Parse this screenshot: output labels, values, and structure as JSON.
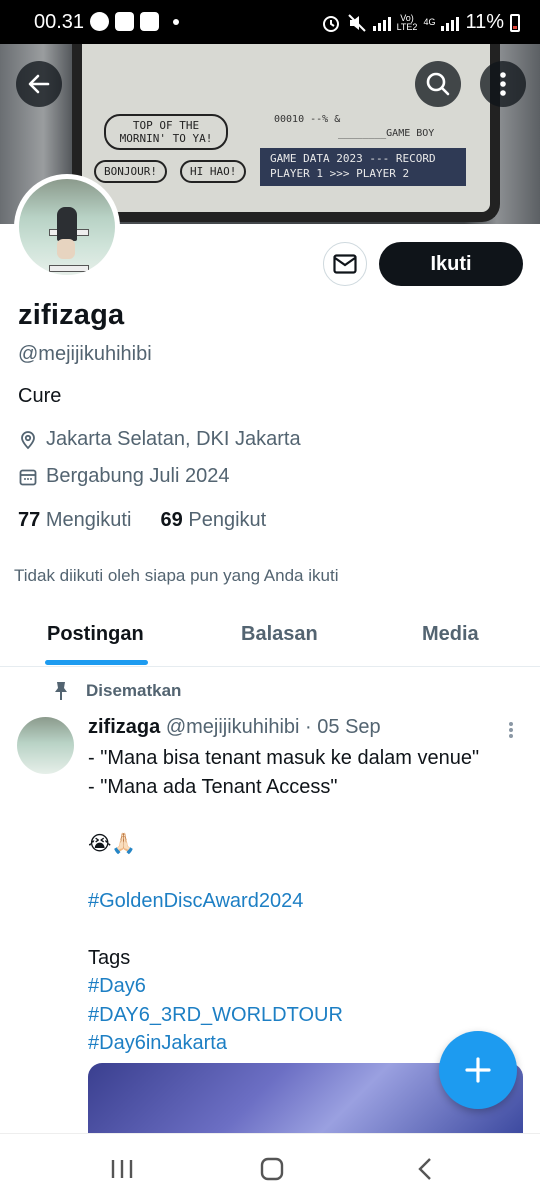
{
  "status_bar": {
    "time": "00.31",
    "network_small_1": "Vo)",
    "network_small_2": "LTE2",
    "network_type": "4G",
    "battery": "11%"
  },
  "banner": {
    "bubble_1": "TOP OF THE MORNIN' TO YA!",
    "bubble_2": "BONJOUR!",
    "bubble_3": "HI HAO!",
    "score_text": "00010 --% &",
    "game_boy_text": "________GAME BOY",
    "record_line_1": "GAME DATA  2023 --- RECORD",
    "record_line_2": "PLAYER 1  >>>  PLAYER 2"
  },
  "profile": {
    "follow_label": "Ikuti",
    "name": "zifizaga",
    "handle": "@mejijikuhihibi",
    "bio": "Cure",
    "location": "Jakarta Selatan, DKI Jakarta",
    "joined": "Bergabung Juli 2024",
    "following_count": "77",
    "following_label": "Mengikuti",
    "followers_count": "69",
    "followers_label": "Pengikut",
    "not_followed_text": "Tidak diikuti oleh siapa pun yang Anda ikuti"
  },
  "tabs": [
    {
      "label": "Postingan",
      "active": true
    },
    {
      "label": "Balasan",
      "active": false
    },
    {
      "label": "Media",
      "active": false
    }
  ],
  "pinned_post": {
    "pinned_label": "Disematkan",
    "author": "zifizaga",
    "handle_date": "@mejijikuhihibi · 05 Sep",
    "lines": [
      "- \"Mana bisa tenant masuk ke dalam venue\"",
      "- \"Mana ada Tenant Access\"",
      "",
      "😭🙏🏻",
      "",
      "#GoldenDiscAward2024",
      "",
      "Tags",
      "#Day6",
      "#DAY6_3RD_WORLDTOUR",
      "#Day6inJakarta"
    ]
  },
  "colors": {
    "accent": "#1d9bf0",
    "text_primary": "#0f1419",
    "text_secondary": "#536471"
  }
}
